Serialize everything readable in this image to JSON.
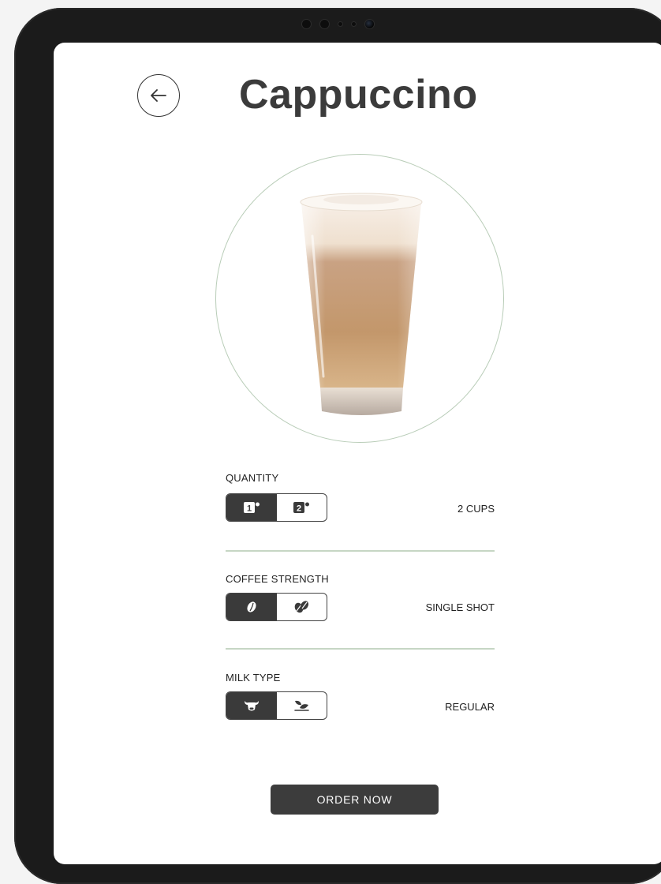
{
  "header": {
    "title": "Cappuccino"
  },
  "quantity": {
    "label": "QUANTITY",
    "options": [
      "1",
      "2"
    ],
    "selected_index": 0,
    "value": "2 CUPS"
  },
  "strength": {
    "label": "COFFEE STRENGTH",
    "options_icons": [
      "single-bean-icon",
      "double-bean-icon"
    ],
    "selected_index": 0,
    "value": "SINGLE SHOT"
  },
  "milk": {
    "label": "MILK TYPE",
    "options_icons": [
      "cow-icon",
      "leaf-icon"
    ],
    "selected_index": 0,
    "value": "REGULAR"
  },
  "order": {
    "label": "ORDER NOW"
  },
  "colors": {
    "accent_dark": "#3a3a3a",
    "divider_green": "#c6d6c4",
    "circle_green": "#b9cdb8"
  }
}
